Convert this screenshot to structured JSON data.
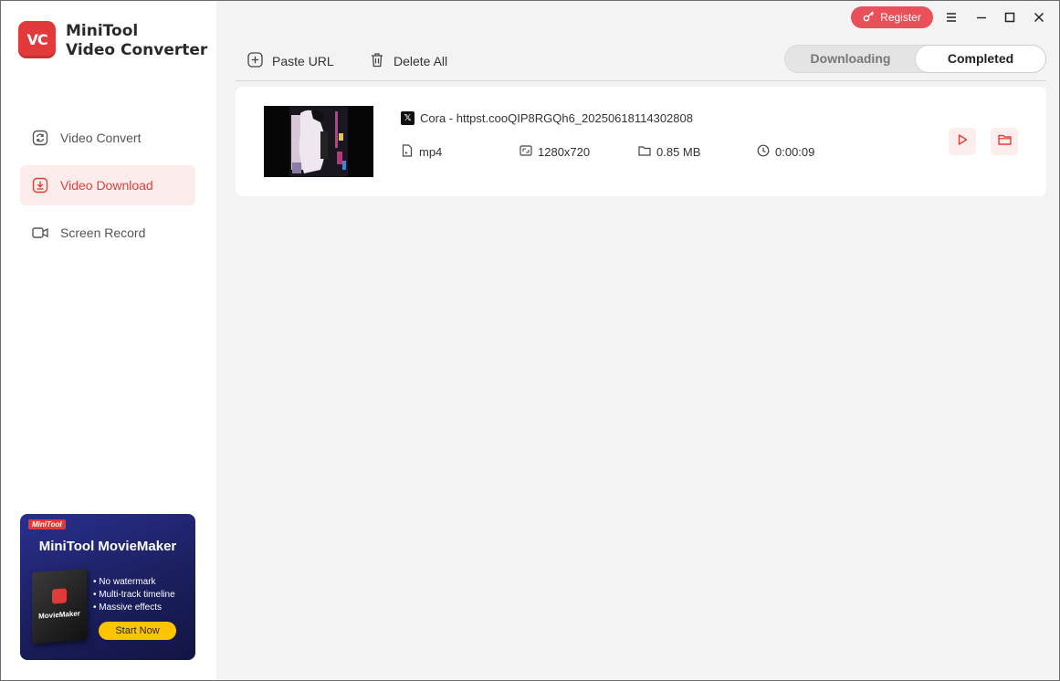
{
  "app": {
    "logo_text": "VC",
    "name_line1": "MiniTool",
    "name_line2": "Video Converter"
  },
  "sidebar": {
    "items": [
      {
        "label": "Video Convert",
        "icon": "convert-icon",
        "active": false
      },
      {
        "label": "Video Download",
        "icon": "download-icon",
        "active": true
      },
      {
        "label": "Screen Record",
        "icon": "camera-icon",
        "active": false
      }
    ]
  },
  "ad": {
    "brand": "MiniTool",
    "title": "MiniTool MovieMaker",
    "box_label": "MovieMaker",
    "features": [
      "No watermark",
      "Multi-track timeline",
      "Massive effects"
    ],
    "button": "Start Now"
  },
  "titlebar": {
    "register": "Register"
  },
  "toolbar": {
    "paste_url": "Paste URL",
    "delete_all": "Delete All"
  },
  "tabs": {
    "downloading": "Downloading",
    "completed": "Completed",
    "selected": "Completed"
  },
  "download": {
    "source_icon": "x-logo-icon",
    "source_badge": "𝕏",
    "title": "Cora - httpst.cooQIP8RGQh6_20250618114302808",
    "format": "mp4",
    "resolution": "1280x720",
    "size": "0.85 MB",
    "duration": "0:00:09"
  },
  "colors": {
    "accent": "#e0403a",
    "register_bg": "#e9505a",
    "sidebar_active_bg": "#fdecec",
    "ad_button": "#ffc400"
  }
}
